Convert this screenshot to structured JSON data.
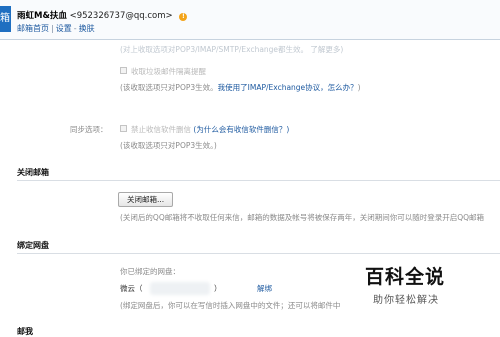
{
  "header": {
    "logo_fragment": "箱",
    "account_name": "雨虹M&扶血",
    "account_email": "<952326737@qq.com>",
    "warn_icon_glyph": "!",
    "nav": {
      "home": "邮箱首页",
      "separator": "|",
      "settings": "设置",
      "switch": "换肤"
    }
  },
  "top_settings": {
    "faded_line": "(对上收取选项对POP3/IMAP/SMTP/Exchange都生效。 了解更多)",
    "junk_checkbox_label": "收取垃圾邮件隔离提醒",
    "pop3_note_prefix": "(该收取选项只对POP3生效。",
    "pop3_note_link": "我使用了IMAP/Exchange协议，怎么办？",
    "pop3_note_suffix": ")"
  },
  "sync": {
    "label": "同步选项：",
    "checkbox_label": "禁止收信软件删信",
    "checkbox_link": "(为什么会有收信软件删信？)",
    "note": "(该收取选项只对POP3生效。)"
  },
  "close_mailbox": {
    "title": "关闭邮箱",
    "button_label": "关闭邮箱...",
    "note": "(关闭后的QQ邮箱将不收取任何来信，邮箱的数据及帐号将被保存两年，关闭期间你可以随时登录开启QQ邮箱"
  },
  "netdisk": {
    "title": "绑定网盘",
    "bound_label": "你已绑定的网盘：",
    "provider": "微云（",
    "provider_close": "）",
    "unbind_link": "解绑",
    "note": "(绑定网盘后，你可以在写信时插入网盘中的文件；还可以将邮件中"
  },
  "next_section": {
    "title": "邮我"
  },
  "watermark": {
    "title": "百科全说",
    "subtitle": "助你轻松解决"
  }
}
